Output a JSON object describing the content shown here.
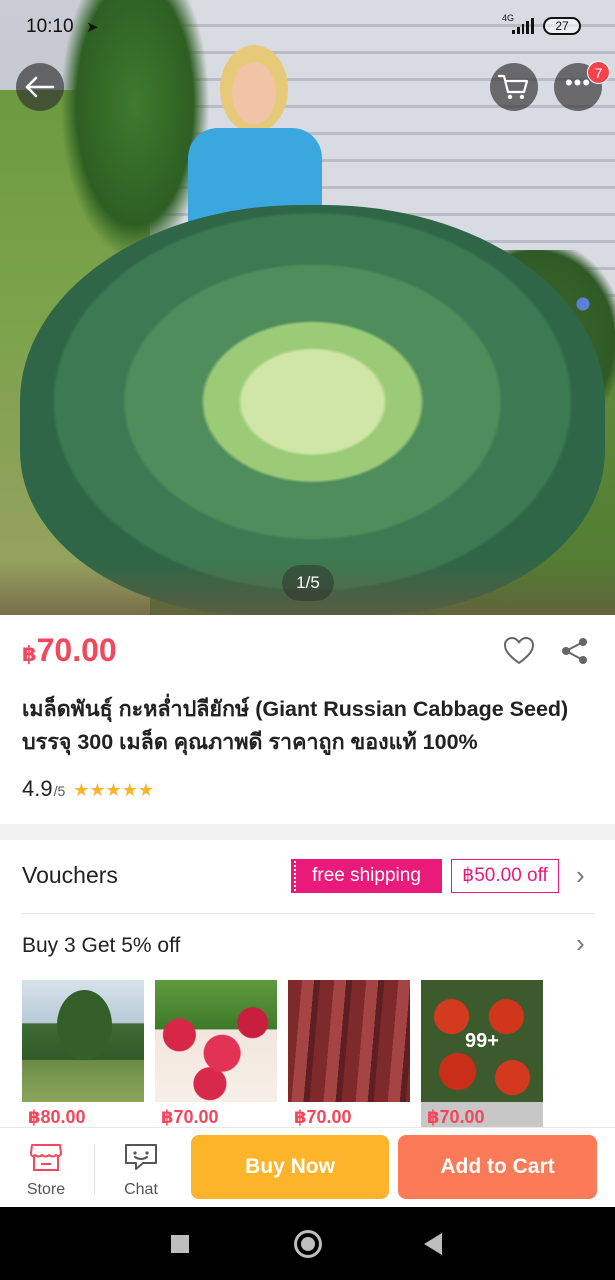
{
  "status_bar": {
    "time": "10:10",
    "network": "4G",
    "battery": "27"
  },
  "gallery": {
    "pager": "1/5",
    "cart_badge": "7"
  },
  "product": {
    "currency": "฿",
    "price": "70.00",
    "title": "เมล็ดพันธุ์ กะหล่ำปลียักษ์ (Giant Russian Cabbage Seed) บรรจุ 300 เมล็ด คุณภาพดี ราคาถูก ของแท้ 100%",
    "rating": "4.9",
    "rating_denominator": "/5",
    "stars": "★★★★★"
  },
  "vouchers": {
    "title": "Vouchers",
    "chips": [
      "free shipping",
      "฿50.00 off"
    ]
  },
  "promotion": {
    "title": "Buy 3 Get 5% off",
    "items": [
      {
        "price": "฿80.00"
      },
      {
        "price": "฿70.00"
      },
      {
        "price": "฿70.00"
      },
      {
        "price": "฿70.00",
        "overlay": "99+"
      }
    ]
  },
  "bottom_bar": {
    "store_label": "Store",
    "chat_label": "Chat",
    "buy_now_label": "Buy Now",
    "add_to_cart_label": "Add to Cart"
  },
  "colors": {
    "price": "#f5475b",
    "voucher_pink": "#ea1a7b",
    "buy_now": "#fdb32a",
    "add_to_cart": "#fb7b58",
    "star": "#f7b52b"
  },
  "icons": [
    "back-arrow-icon",
    "cart-icon",
    "more-icon",
    "heart-icon",
    "share-icon",
    "chevron-right-icon",
    "store-icon",
    "chat-icon"
  ]
}
